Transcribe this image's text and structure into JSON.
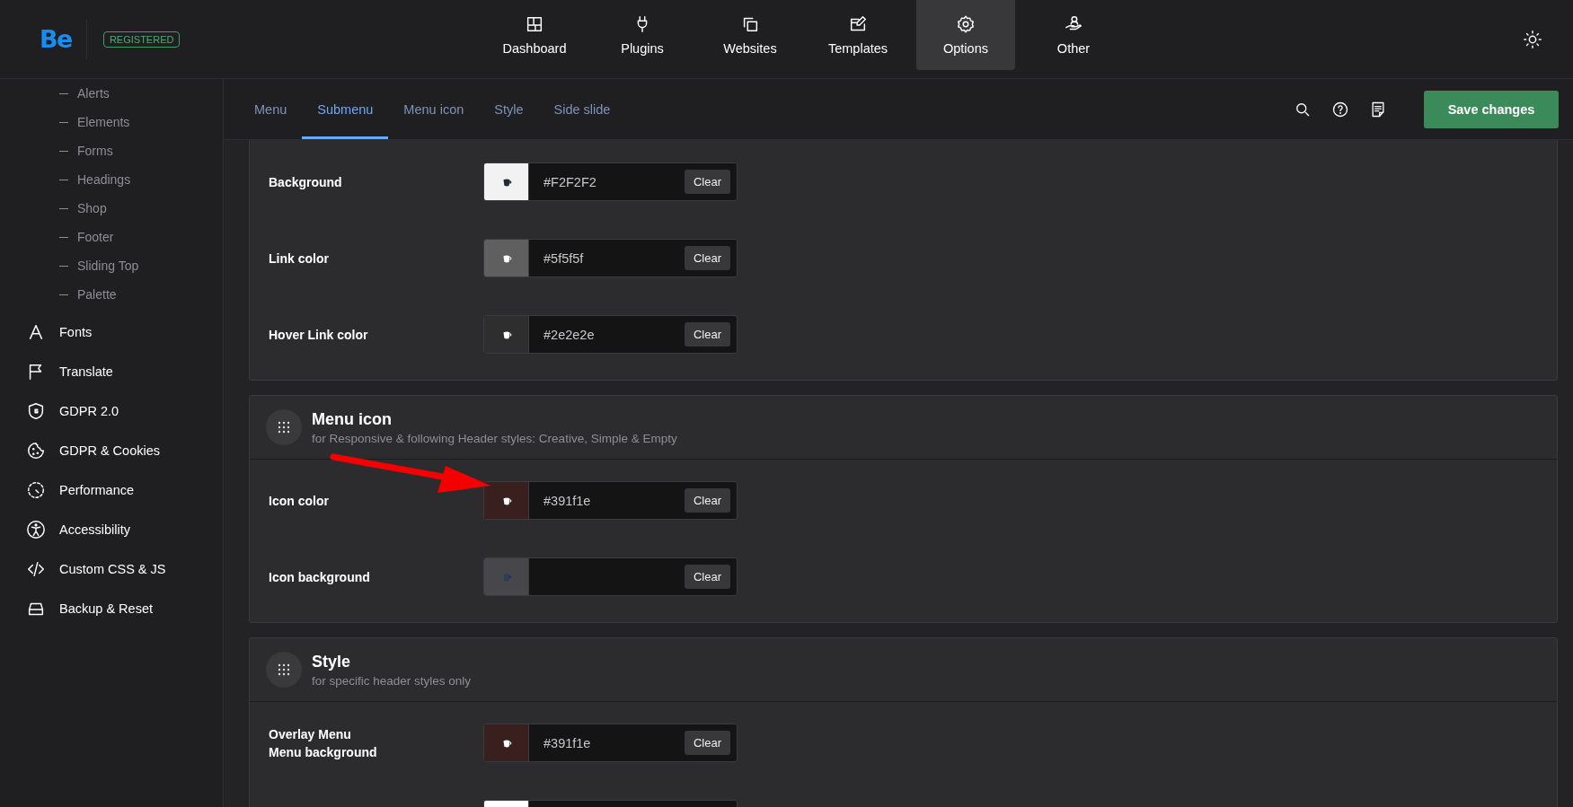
{
  "header": {
    "logo": "Be",
    "badge": "REGISTERED"
  },
  "nav": [
    {
      "label": "Dashboard",
      "selected": false
    },
    {
      "label": "Plugins",
      "selected": false
    },
    {
      "label": "Websites",
      "selected": false
    },
    {
      "label": "Templates",
      "selected": false
    },
    {
      "label": "Options",
      "selected": true
    },
    {
      "label": "Other",
      "selected": false
    }
  ],
  "sidebar": {
    "subitems": [
      "Alerts",
      "Elements",
      "Forms",
      "Headings",
      "Shop",
      "Footer",
      "Sliding Top",
      "Palette"
    ],
    "items": [
      "Fonts",
      "Translate",
      "GDPR 2.0",
      "GDPR & Cookies",
      "Performance",
      "Accessibility",
      "Custom CSS & JS",
      "Backup & Reset"
    ]
  },
  "tabs": [
    {
      "label": "Menu",
      "selected": false
    },
    {
      "label": "Submenu",
      "selected": true
    },
    {
      "label": "Menu icon",
      "selected": false
    },
    {
      "label": "Style",
      "selected": false
    },
    {
      "label": "Side slide",
      "selected": false
    }
  ],
  "save_button": "Save changes",
  "sections": [
    {
      "rows": [
        {
          "label": "Background",
          "color": "#f2f2f2",
          "value": "#F2F2F2",
          "button": "Clear"
        },
        {
          "label": "Link color",
          "color": "#5f5f5f",
          "value": "#5f5f5f",
          "button": "Clear"
        },
        {
          "label": "Hover Link color",
          "color": "#2e2e2e",
          "value": "#2e2e2e",
          "button": "Clear"
        }
      ]
    },
    {
      "title": "Menu icon",
      "subtitle": "for Responsive & following Header styles: Creative, Simple & Empty",
      "rows": [
        {
          "label": "Icon color",
          "color": "#391f1e",
          "value": "#391f1e",
          "button": "Clear"
        },
        {
          "label": "Icon background",
          "color": "#46464b",
          "button": "Clear"
        }
      ]
    },
    {
      "title": "Style",
      "subtitle": "for specific header styles only",
      "rows": [
        {
          "label": "Overlay Menu\nMenu background",
          "color": "#391f1e",
          "value": "#391f1e",
          "button": "Clear"
        },
        {
          "color": "#ffffff"
        }
      ]
    }
  ]
}
